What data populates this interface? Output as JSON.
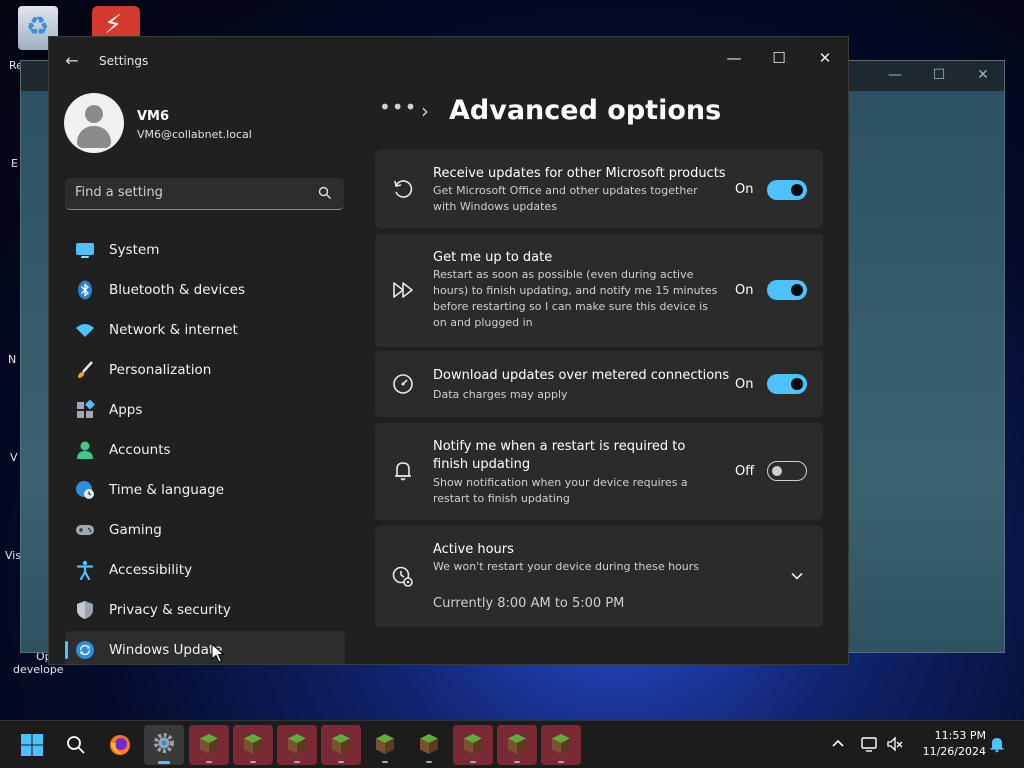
{
  "desktop": {
    "icons": [
      {
        "label": "Re"
      },
      {
        "label": "E"
      },
      {
        "label": "N"
      },
      {
        "label": "V"
      },
      {
        "label": "Vis"
      },
      {
        "label": "Ope"
      },
      {
        "label": "develope"
      }
    ]
  },
  "window": {
    "title": "Settings"
  },
  "user": {
    "name": "VM6",
    "email": "VM6@collabnet.local"
  },
  "search": {
    "placeholder": "Find a setting"
  },
  "nav": {
    "items": [
      {
        "label": "System",
        "icon": "monitor-icon"
      },
      {
        "label": "Bluetooth & devices",
        "icon": "bluetooth-icon"
      },
      {
        "label": "Network & internet",
        "icon": "wifi-icon"
      },
      {
        "label": "Personalization",
        "icon": "brush-icon"
      },
      {
        "label": "Apps",
        "icon": "apps-icon"
      },
      {
        "label": "Accounts",
        "icon": "person-icon"
      },
      {
        "label": "Time & language",
        "icon": "globe-clock-icon"
      },
      {
        "label": "Gaming",
        "icon": "gamepad-icon"
      },
      {
        "label": "Accessibility",
        "icon": "accessibility-icon"
      },
      {
        "label": "Privacy & security",
        "icon": "shield-icon"
      },
      {
        "label": "Windows Update",
        "icon": "sync-icon"
      }
    ],
    "selected": "Windows Update"
  },
  "breadcrumb": {
    "dots": "•••",
    "separator": "›"
  },
  "page": {
    "title": "Advanced options"
  },
  "cards": [
    {
      "title": "Receive updates for other Microsoft products",
      "desc": "Get Microsoft Office and other updates together with Windows updates",
      "state": "On",
      "on": true,
      "icon": "refresh-icon"
    },
    {
      "title": "Get me up to date",
      "desc": "Restart as soon as possible (even during active hours) to finish updating, and notify me 15 minutes before restarting so I can make sure this device is on and plugged in",
      "state": "On",
      "on": true,
      "icon": "fast-forward-icon"
    },
    {
      "title": "Download updates over metered connections",
      "desc": "Data charges may apply",
      "state": "On",
      "on": true,
      "icon": "gauge-icon"
    },
    {
      "title": "Notify me when a restart is required to finish updating",
      "desc": "Show notification when your device requires a restart to finish updating",
      "state": "Off",
      "on": false,
      "icon": "bell-icon"
    }
  ],
  "active_hours": {
    "title": "Active hours",
    "desc": "We won't restart your device during these hours",
    "current": "Currently 8:00 AM to 5:00 PM",
    "icon": "clock-gear-icon"
  },
  "taskbar": {
    "time": "11:53 PM",
    "date": "11/26/2024"
  },
  "colors": {
    "accent": "#4cc2ff",
    "window_bg": "#202020",
    "card_bg": "#2b2b2b"
  }
}
